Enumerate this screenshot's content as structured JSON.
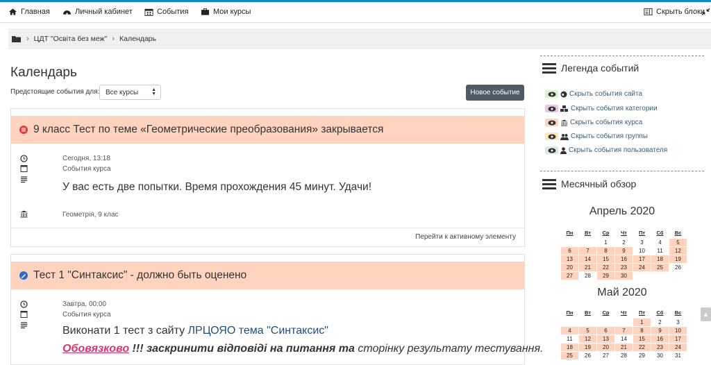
{
  "nav": {
    "home": "Главная",
    "dashboard": "Личный кабинет",
    "events": "События",
    "courses": "Мои курсы",
    "hide_blocks": "Скрыть блоки"
  },
  "breadcrumb": {
    "items": [
      "ЦДТ \"Освіта без меж\"",
      "Календарь"
    ]
  },
  "page": {
    "title": "Календарь",
    "filter_label": "Предстоящие события для:",
    "filter_value": "Все курсы",
    "new_event": "Новое событие"
  },
  "events": [
    {
      "title": "9 класс Тест по теме «Геометрические преобразования» закрывается",
      "time": "Сегодня, 13:18",
      "type": "События курса",
      "description": "У вас есть две попытки. Время прохождения 45 минут. Удачи!",
      "course": "Геометрія, 9 клас",
      "goto": "Перейти к активному элементу"
    },
    {
      "title": "Тест 1 \"Синтаксис\" - должно быть оценено",
      "time": "Завтра, 00:00",
      "type": "События курса",
      "desc1_a": "Виконати 1 тест з сайту ",
      "desc1_b": "ЛРЦОЯО тема \"Синтаксис\"",
      "desc2_a": "Обовязково",
      "desc2_b": " !!! заскринити відповіді на питання та",
      "desc2_c": " сторінку результату тестування."
    }
  ],
  "legend": {
    "title": "Легенда событий",
    "items": [
      {
        "label": "Скрыть события сайта",
        "color": "#d6f5cc"
      },
      {
        "label": "Скрыть события категории",
        "color": "#e6c8e6"
      },
      {
        "label": "Скрыть события курса",
        "color": "#ffd3bd"
      },
      {
        "label": "Скрыть события группы",
        "color": "#fee7ae"
      },
      {
        "label": "Скрыть события пользователя",
        "color": "#dce7ec"
      }
    ]
  },
  "monthly": {
    "title": "Месячный обзор",
    "weekdays": [
      "Пн",
      "Вт",
      "Ср",
      "Чт",
      "Пт",
      "Сб",
      "Вс"
    ],
    "months": [
      {
        "name": "Апрель 2020",
        "weeks": [
          [
            "",
            "",
            "1",
            "2",
            "3",
            "4",
            "5"
          ],
          [
            "6",
            "7",
            "8",
            "9",
            "10",
            "11",
            "12"
          ],
          [
            "13",
            "14",
            "15",
            "16",
            "17",
            "18",
            "19"
          ],
          [
            "20",
            "21",
            "22",
            "23",
            "24",
            "25",
            "26"
          ],
          [
            "27",
            "28",
            "29",
            "30",
            "",
            "",
            ""
          ]
        ],
        "event_days": [
          "5",
          "6",
          "7",
          "8",
          "9",
          "12",
          "13",
          "14",
          "15",
          "16",
          "17",
          "18",
          "19",
          "20",
          "21",
          "22",
          "23",
          "24",
          "25",
          "27",
          "29",
          "30"
        ]
      },
      {
        "name": "Май 2020",
        "weeks": [
          [
            "",
            "",
            "",
            "",
            "1",
            "2",
            "3"
          ],
          [
            "4",
            "5",
            "6",
            "7",
            "8",
            "9",
            "10"
          ],
          [
            "11",
            "12",
            "13",
            "14",
            "15",
            "16",
            "17"
          ],
          [
            "18",
            "19",
            "20",
            "21",
            "22",
            "23",
            "24"
          ],
          [
            "25",
            "26",
            "27",
            "28",
            "29",
            "30",
            "31"
          ]
        ],
        "event_days": [
          "1",
          "4",
          "5",
          "6",
          "7",
          "8",
          "9",
          "10",
          "12",
          "13",
          "15",
          "16",
          "17",
          "18",
          "19",
          "20",
          "21",
          "22",
          "23",
          "24",
          "25"
        ]
      }
    ]
  },
  "colors": {
    "accent": "#0f8ec6",
    "course_event": "#ffd3bd",
    "primary_button": "#4c5b64"
  }
}
